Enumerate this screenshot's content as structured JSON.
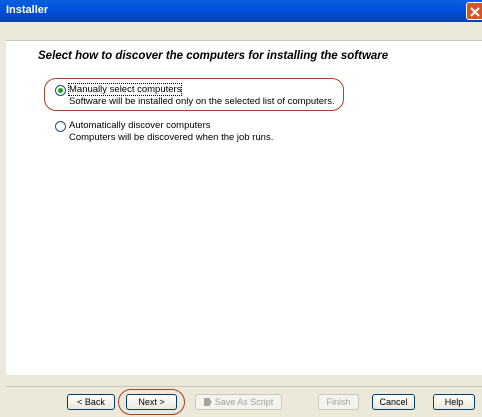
{
  "window": {
    "title": "Installer"
  },
  "heading": "Select how to discover the computers for installing the software",
  "options": [
    {
      "label": "Manually select computers",
      "description": "Software will be installed only on the selected list of computers.",
      "selected": true
    },
    {
      "label": "Automatically discover computers",
      "description": "Computers will be discovered when the job runs.",
      "selected": false
    }
  ],
  "buttons": {
    "back": "< Back",
    "next": "Next >",
    "save_script": "Save As Script",
    "finish": "Finish",
    "cancel": "Cancel",
    "help": "Help"
  },
  "colors": {
    "titlebar": "#0053e1",
    "highlight": "#a4422a",
    "radio_selected": "#21a121"
  }
}
